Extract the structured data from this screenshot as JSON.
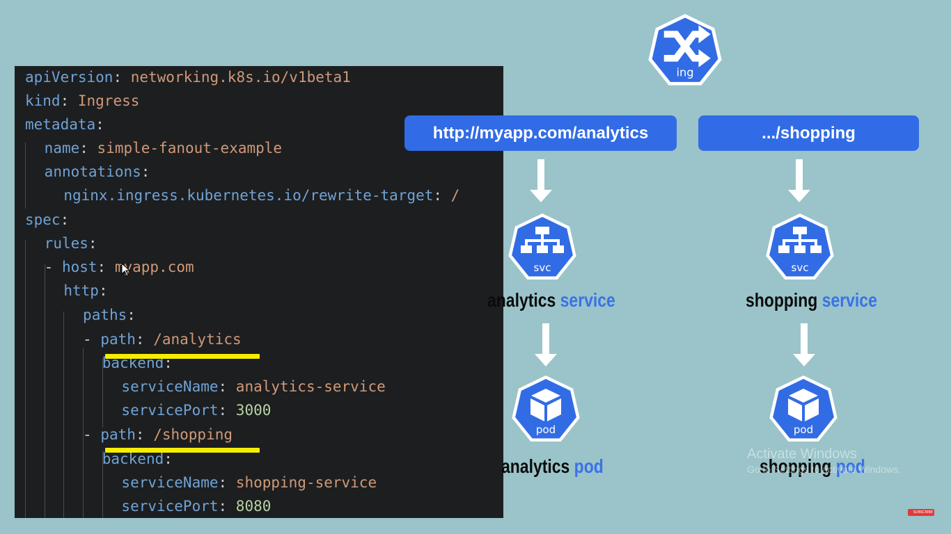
{
  "code": {
    "lines": [
      {
        "k": "apiVersion",
        "p": ": ",
        "v": "networking.k8s.io/v1beta1",
        "t": "str"
      },
      {
        "k": "kind",
        "p": ": ",
        "v": "Ingress",
        "t": "str"
      },
      {
        "k": "metadata",
        "p": ":",
        "v": "",
        "t": "str"
      },
      {
        "k": "name",
        "p": ": ",
        "v": "simple-fanout-example",
        "t": "str"
      },
      {
        "k": "annotations",
        "p": ":",
        "v": "",
        "t": "str"
      },
      {
        "k": "nginx.ingress.kubernetes.io/rewrite-target",
        "p": ": ",
        "v": "/",
        "t": "str"
      },
      {
        "k": "spec",
        "p": ":",
        "v": "",
        "t": "str"
      },
      {
        "k": "rules",
        "p": ":",
        "v": "",
        "t": "str"
      },
      {
        "d": "- ",
        "k": "host",
        "p": ": ",
        "v": "myapp.com",
        "t": "str"
      },
      {
        "k": "http",
        "p": ":",
        "v": "",
        "t": "str"
      },
      {
        "k": "paths",
        "p": ":",
        "v": "",
        "t": "str"
      },
      {
        "d": "- ",
        "k": "path",
        "p": ": ",
        "v": "/analytics",
        "t": "str"
      },
      {
        "k": "backend",
        "p": ":",
        "v": "",
        "t": "str"
      },
      {
        "k": "serviceName",
        "p": ": ",
        "v": "analytics-service",
        "t": "str"
      },
      {
        "k": "servicePort",
        "p": ": ",
        "v": "3000",
        "t": "num"
      },
      {
        "d": "- ",
        "k": "path",
        "p": ": ",
        "v": "/shopping",
        "t": "str"
      },
      {
        "k": "backend",
        "p": ":",
        "v": "",
        "t": "str"
      },
      {
        "k": "serviceName",
        "p": ": ",
        "v": "shopping-service",
        "t": "str"
      },
      {
        "k": "servicePort",
        "p": ": ",
        "v": "8080",
        "t": "num"
      }
    ]
  },
  "diagram": {
    "ingress_icon_label": "ing",
    "routes": [
      {
        "label": "http://myapp.com/analytics"
      },
      {
        "label": ".../shopping"
      }
    ],
    "services": [
      {
        "icon_label": "svc",
        "name": "analytics",
        "suffix": "service"
      },
      {
        "icon_label": "svc",
        "name": "shopping",
        "suffix": "service"
      }
    ],
    "pods": [
      {
        "icon_label": "pod",
        "name": "analytics",
        "suffix": "pod"
      },
      {
        "icon_label": "pod",
        "name": "shopping",
        "suffix": "pod"
      }
    ]
  },
  "colors": {
    "background": "#9ac4c9",
    "code_bg": "#1d1e20",
    "k8s_blue": "#326ce5",
    "highlight": "#f6ee00",
    "label_blue": "#3a72e8"
  },
  "watermark": {
    "title": "Activate Windows",
    "subtitle": "Go to Settings to activate Windows."
  },
  "badge": {
    "label": "SUBSCRIBE"
  }
}
